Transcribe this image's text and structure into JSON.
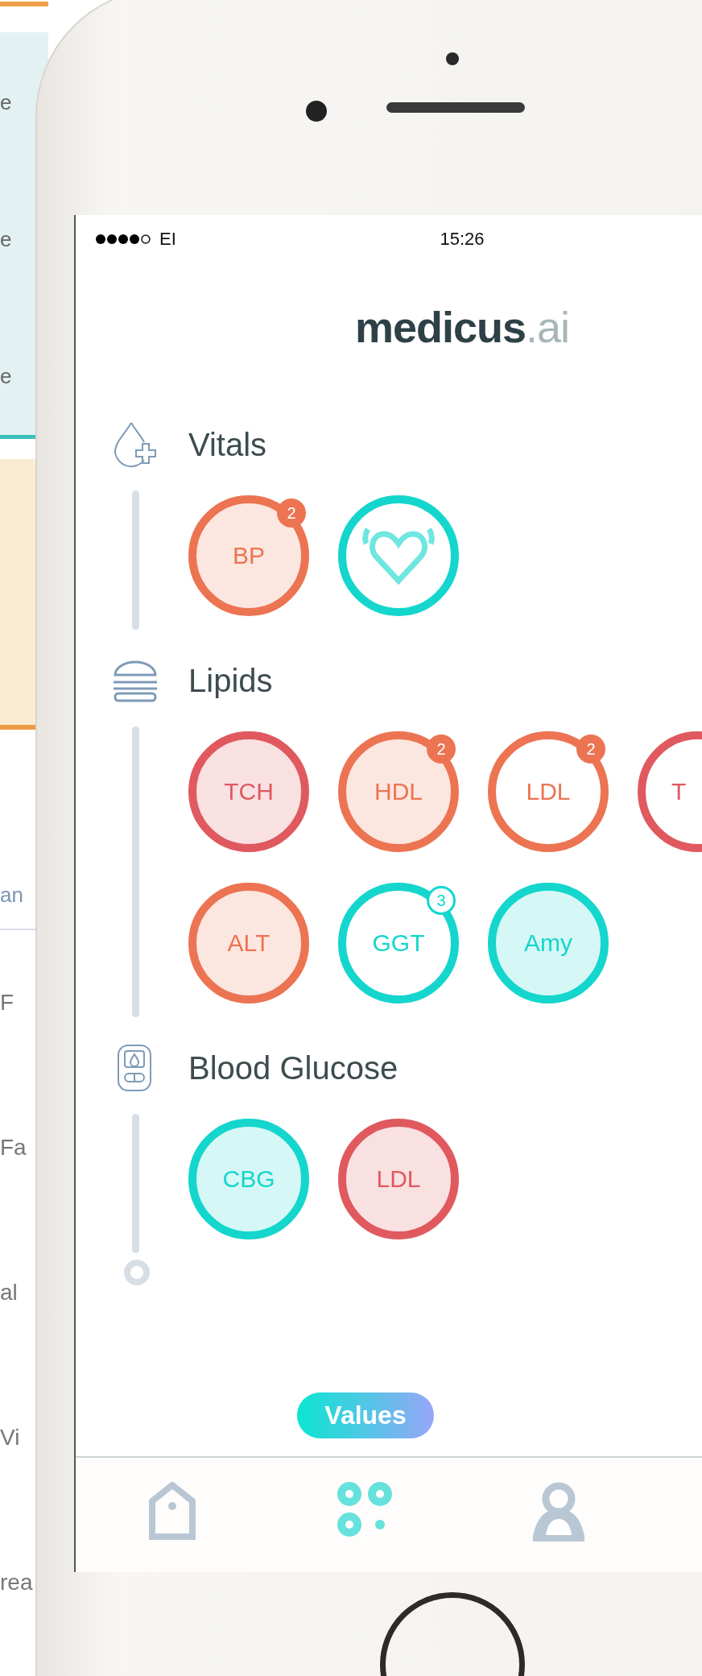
{
  "background_page": {
    "panel_texts": [
      "e",
      "e",
      "e"
    ],
    "list_header": "an",
    "list_texts": [
      "F",
      "Fa",
      "al",
      "Vi",
      "rea"
    ]
  },
  "status_bar": {
    "carrier": "EI",
    "time": "15:26"
  },
  "logo": {
    "main": "medicus",
    "suffix": ".ai"
  },
  "sections": [
    {
      "title": "Vitals",
      "kind": "drop",
      "tests": [
        {
          "kind": "label",
          "label": "BP",
          "color": "#ec7452",
          "filled": true,
          "clipped": false,
          "badge": {
            "text": "2",
            "filled": true
          }
        },
        {
          "kind": "heart",
          "color": "#14d6cd",
          "filled": false,
          "clipped": false
        }
      ]
    },
    {
      "title": "Lipids",
      "kind": "burger",
      "tests": [
        {
          "kind": "label",
          "label": "TCH",
          "color": "#e0595f",
          "filled": true,
          "clipped": false
        },
        {
          "kind": "label",
          "label": "HDL",
          "color": "#ec7452",
          "filled": true,
          "clipped": false,
          "badge": {
            "text": "2",
            "filled": true
          }
        },
        {
          "kind": "label",
          "label": "LDL",
          "color": "#ec7452",
          "filled": false,
          "clipped": false,
          "badge": {
            "text": "2",
            "filled": true
          }
        },
        {
          "kind": "label",
          "label": "T",
          "color": "#e0595f",
          "filled": false,
          "clipped": true
        },
        {
          "kind": "label",
          "label": "ALT",
          "color": "#ec7452",
          "filled": true,
          "clipped": false
        },
        {
          "kind": "label",
          "label": "GGT",
          "color": "#14d6cd",
          "filled": false,
          "clipped": false,
          "badge": {
            "text": "3",
            "filled": false
          }
        },
        {
          "kind": "label",
          "label": "Amy",
          "color": "#14d6cd",
          "filled": true,
          "clipped": false
        }
      ]
    },
    {
      "title": "Blood Glucose",
      "kind": "meter",
      "tests": [
        {
          "kind": "label",
          "label": "CBG",
          "color": "#14d6cd",
          "filled": true,
          "clipped": false
        },
        {
          "kind": "label",
          "label": "LDL",
          "color": "#e0595f",
          "filled": true,
          "clipped": false
        }
      ]
    }
  ],
  "values_pill": {
    "label": "Values"
  },
  "tabs": [
    {
      "kind": "home",
      "selected": false
    },
    {
      "kind": "grid",
      "selected": true
    },
    {
      "kind": "person",
      "selected": false
    }
  ]
}
